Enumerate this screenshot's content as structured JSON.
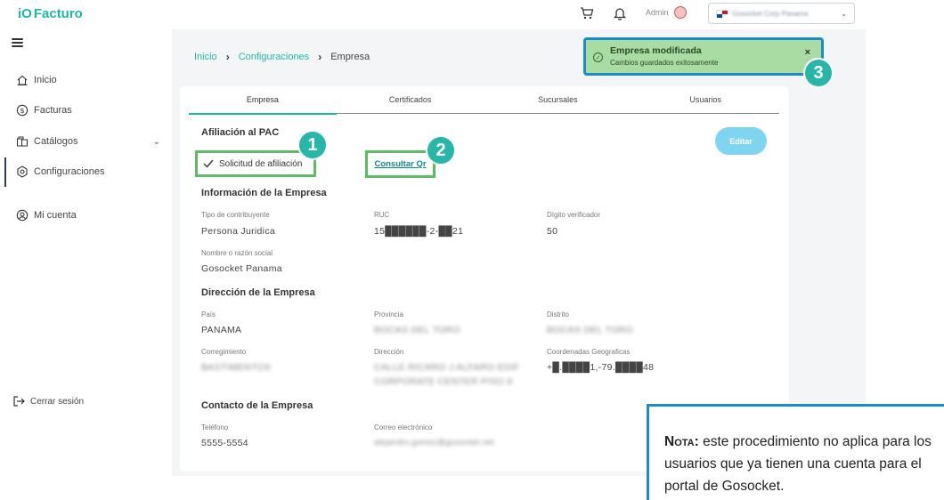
{
  "app": {
    "logo_mark": "iO",
    "logo_text": "Facturo"
  },
  "header": {
    "user_label": "Admin",
    "company": "Gosocket Corp Panama"
  },
  "sidebar": {
    "items": [
      {
        "label": "Inicio",
        "icon": "home-icon"
      },
      {
        "label": "Facturas",
        "icon": "dollar-icon"
      },
      {
        "label": "Catálogos",
        "icon": "catalog-icon"
      },
      {
        "label": "Configuraciones",
        "icon": "gear-icon"
      },
      {
        "label": "Mi cuenta",
        "icon": "account-icon"
      }
    ],
    "logout": "Cerrar sesión"
  },
  "breadcrumb": [
    "Inicio",
    "Configuraciones",
    "Empresa"
  ],
  "toast": {
    "title": "Empresa modificada",
    "message": "Cambios guardados exitosamente",
    "close": "×"
  },
  "tabs": [
    "Empresa",
    "Certificados",
    "Sucursales",
    "Usuarios"
  ],
  "afiliacion": {
    "title": "Afiliación al PAC",
    "status": "Solicitud de afiliación",
    "qr_link": "Consultar Qr",
    "edit_button": "Editar"
  },
  "info": {
    "title": "Información de la Empresa",
    "tipo_label": "Tipo de contribuyente",
    "tipo": "Persona Juridica",
    "ruc_label": "RUC",
    "ruc": "15██████-2-██21",
    "dv_label": "Dígito verificador",
    "dv": "50",
    "nombre_label": "Nombre o razón social",
    "nombre": "Gosocket Panama"
  },
  "direccion": {
    "title": "Dirección de la Empresa",
    "pais_label": "País",
    "pais": "PANAMA",
    "provincia_label": "Provincia",
    "provincia": "BOCAS DEL TORO",
    "distrito_label": "Distrito",
    "distrito": "BOCAS DEL TORO",
    "correg_label": "Corregimiento",
    "correg": "BASTIMENTOS",
    "dir_label": "Dirección",
    "dir1": "CALLE RICARO J ALFARO EDIF",
    "dir2": "CORPORATE CENTER PISO 8",
    "coord_label": "Coordenadas Geograficas",
    "coord": "+█.████1,-79.████48"
  },
  "contacto": {
    "title": "Contacto de la Empresa",
    "tel_label": "Teléfono",
    "tel": "5555-5554",
    "email_label": "Correo electrónico",
    "email": "alejandro.gomez@gosocket.net"
  },
  "badges": [
    "1",
    "2",
    "3"
  ],
  "note": {
    "label": "Nota:",
    "text": "este procedimiento no aplica para los usuarios que ya tienen una cuenta para el portal de Gosocket."
  },
  "colors": {
    "accent": "#1fb8a6",
    "callout": "#5dbb63",
    "badge": "#27b6a8",
    "note_border": "#1a8cc8"
  }
}
